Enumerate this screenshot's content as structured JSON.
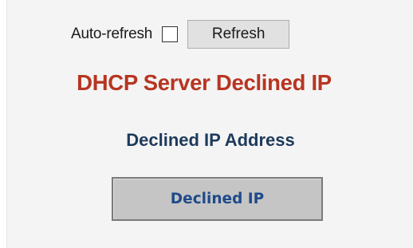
{
  "toolbar": {
    "auto_refresh_label": "Auto-refresh",
    "auto_refresh_checked": false,
    "refresh_label": "Refresh"
  },
  "page": {
    "title": "DHCP Server Declined IP",
    "section_heading": "Declined IP Address"
  },
  "table": {
    "columns": [
      "Declined IP"
    ],
    "rows": []
  },
  "colors": {
    "title": "#b73521",
    "heading": "#1d3a5b",
    "table_header_text": "#1f4a8a",
    "table_header_bg": "#c5c5c5"
  }
}
